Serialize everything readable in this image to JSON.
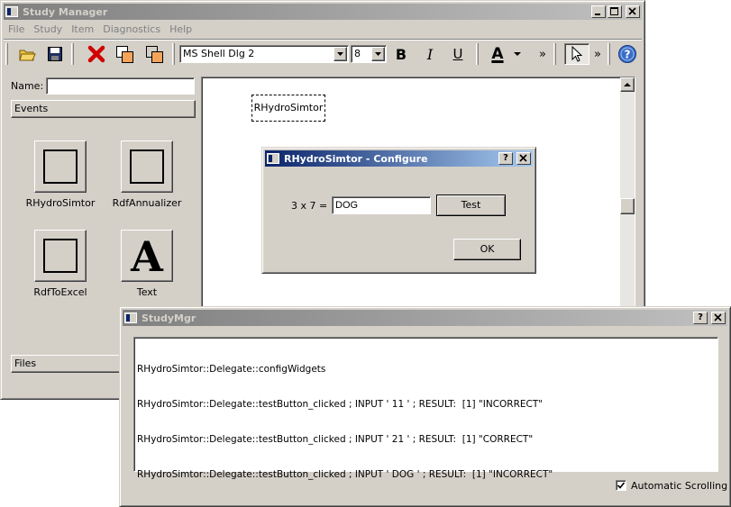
{
  "main_window": {
    "title": "Study Manager",
    "menu": [
      "File",
      "Study",
      "Item",
      "Diagnostics",
      "Help"
    ],
    "toolbar": {
      "font_family": "MS Shell Dlg 2",
      "font_size": "8",
      "bold_label": "B",
      "italic_label": "I",
      "underline_label": "U",
      "font_color_label": "A",
      "overflow_1": "»",
      "overflow_2": "»",
      "help_label": "?"
    },
    "name_label": "Name:",
    "name_value": "",
    "events_header": "Events",
    "files_header": "Files",
    "tiles": [
      {
        "label": "RHydroSimtor",
        "icon": "blank-square"
      },
      {
        "label": "RdfAnnualizer",
        "icon": "blank-square"
      },
      {
        "label": "RdfToExcel",
        "icon": "blank-square"
      },
      {
        "label": "Text",
        "icon": "text-A",
        "glyph": "A"
      }
    ],
    "canvas_node": "RHydroSimtor"
  },
  "configure_dialog": {
    "title": "RHydroSimtor - Configure",
    "question_label": "3 x 7 =",
    "answer_value": "DOG",
    "test_button": "Test",
    "ok_button": "OK",
    "help_btn": "?",
    "close_btn": "✕"
  },
  "log_window": {
    "title": "StudyMgr",
    "help_btn": "?",
    "close_btn": "✕",
    "lines": [
      "RHydroSimtor::Delegate::configWidgets",
      "RHydroSimtor::Delegate::testButton_clicked ; INPUT ' 11 ' ; RESULT:  [1] \"INCORRECT\"",
      "RHydroSimtor::Delegate::testButton_clicked ; INPUT ' 21 ' ; RESULT:  [1] \"CORRECT\"",
      "RHydroSimtor::Delegate::testButton_clicked ; INPUT ' DOG ' ; RESULT:  [1] \"INCORRECT\""
    ],
    "auto_scroll_label": "Automatic Scrolling",
    "auto_scroll_checked": true
  },
  "colors": {
    "face": "#d4d0c8",
    "active_title": "#0a246a",
    "inactive_title": "#808080"
  }
}
